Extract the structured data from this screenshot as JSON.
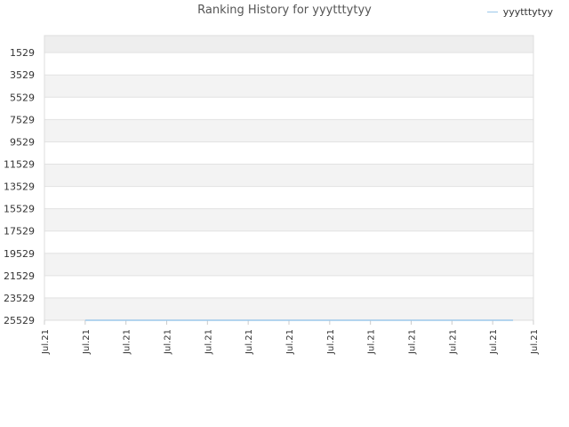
{
  "chart_data": {
    "type": "line",
    "title": "Ranking History for yyytttytyy",
    "legend": {
      "position": "top-right",
      "entries": [
        "yyytttytyy"
      ]
    },
    "y_axis": {
      "inverted": true,
      "ticks": [
        1529,
        3529,
        5529,
        7529,
        9529,
        11529,
        13529,
        15529,
        17529,
        19529,
        21529,
        23529,
        25529
      ],
      "range": [
        25529,
        0
      ]
    },
    "x_axis": {
      "tick_labels": [
        "Jul.21",
        "Jul.21",
        "Jul.21",
        "Jul.21",
        "Jul.21",
        "Jul.21",
        "Jul.21",
        "Jul.21",
        "Jul.21",
        "Jul.21",
        "Jul.21",
        "Jul.21",
        "Jul.21"
      ]
    },
    "series": [
      {
        "name": "yyytttytyy",
        "color": "#9cc8ea",
        "x": [
          1,
          11.5
        ],
        "y": [
          25529,
          25529
        ]
      }
    ],
    "grid": "horizontal alternating bands",
    "band_colors": [
      "#f3f3f3",
      "#ffffff"
    ]
  }
}
